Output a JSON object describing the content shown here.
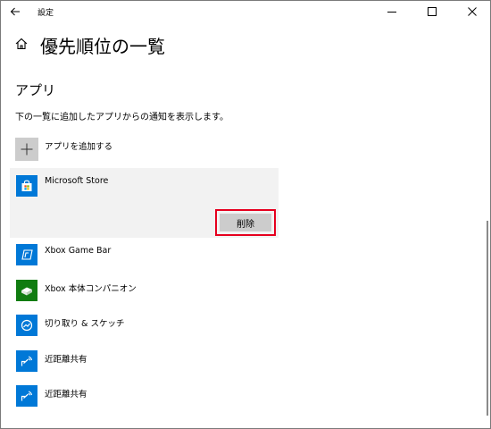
{
  "titlebar": {
    "title": "設定",
    "back_icon": "arrow-left-icon",
    "min_icon": "minimize-icon",
    "max_icon": "maximize-icon",
    "close_icon": "close-icon"
  },
  "header": {
    "home_icon": "home-icon",
    "page_title": "優先順位の一覧"
  },
  "section": {
    "title": "アプリ",
    "description": "下の一覧に追加したアプリからの通知を表示します。"
  },
  "add_app": {
    "label": "アプリを追加する",
    "icon": "plus-icon"
  },
  "selected_app": {
    "name": "Microsoft Store",
    "icon": "store-bag-icon",
    "delete_label": "削除",
    "highlight_color": "#e6001e"
  },
  "apps": [
    {
      "name": "Xbox Game Bar",
      "icon": "xbox-game-bar-icon",
      "tile_color": "#0078d7"
    },
    {
      "name": "Xbox 本体コンパニオン",
      "icon": "xbox-console-icon",
      "tile_color": "#107c10"
    },
    {
      "name": "切り取り & スケッチ",
      "icon": "snip-sketch-icon",
      "tile_color": "#0078d7"
    },
    {
      "name": "近距離共有",
      "icon": "nearby-share-icon",
      "tile_color": "#0078d7"
    },
    {
      "name": "近距離共有",
      "icon": "nearby-share-icon",
      "tile_color": "#0078d7"
    }
  ],
  "colors": {
    "accent_blue": "#0078d7",
    "xbox_green": "#107c10",
    "selected_bg": "#f2f2f2",
    "button_gray": "#cccccc"
  }
}
